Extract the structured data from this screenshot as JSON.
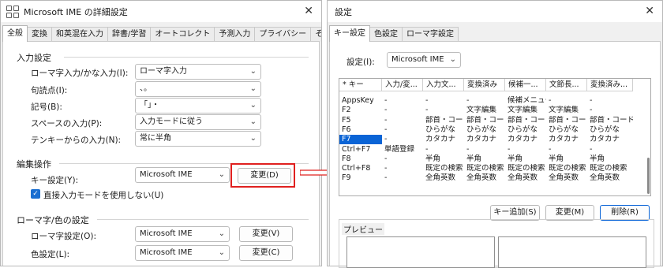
{
  "left_window": {
    "title": "Microsoft IME の詳細設定",
    "tabs": [
      "全般",
      "変換",
      "和英混在入力",
      "辞書/学習",
      "オートコレクト",
      "予測入力",
      "プライバシー",
      "その他"
    ],
    "input_section": {
      "title": "入力設定",
      "rows": [
        {
          "label": "ローマ字入力/かな入力(I):",
          "value": "ローマ字入力"
        },
        {
          "label": "句読点(I):",
          "value": "、。"
        },
        {
          "label": "記号(B):",
          "value": "「」・"
        },
        {
          "label": "スペースの入力(P):",
          "value": "入力モードに従う"
        },
        {
          "label": "テンキーからの入力(N):",
          "value": "常に半角"
        }
      ]
    },
    "edit_section": {
      "title": "編集操作",
      "key_label": "キー設定(Y):",
      "key_value": "Microsoft IME",
      "change_button": "変更(D)",
      "checkbox_label": "直接入力モードを使用しない(U)"
    },
    "romaji_section": {
      "title": "ローマ字/色の設定",
      "romaji_label": "ローマ字設定(O):",
      "romaji_value": "Microsoft IME",
      "romaji_button": "変更(V)",
      "color_label": "色設定(L):",
      "color_value": "Microsoft IME",
      "color_button": "変更(C)"
    }
  },
  "right_window": {
    "title": "設定",
    "tabs": [
      "キー設定",
      "色設定",
      "ローマ字設定"
    ],
    "setting_label": "設定(I):",
    "setting_value": "Microsoft IME",
    "grid": {
      "columns": [
        "* キー",
        "入力/変...",
        "入力文...",
        "変換済み",
        "候補一...",
        "文節長...",
        "変換済み..."
      ],
      "rows": [
        [
          "AppsKey",
          "-",
          "-",
          "-",
          "候補メニュー",
          "-",
          "-"
        ],
        [
          "F2",
          "-",
          "-",
          "文字編集",
          "文字編集",
          "文字編集",
          "-"
        ],
        [
          "F5",
          "-",
          "部首・コード変",
          "部首・コード変",
          "部首・コード変",
          "部首・コード変",
          "部首・コード変"
        ],
        [
          "F6",
          "-",
          "ひらがな",
          "ひらがな",
          "ひらがな",
          "ひらがな",
          "ひらがな"
        ],
        [
          "F7",
          "-",
          "カタカナ",
          "カタカナ",
          "カタカナ",
          "カタカナ",
          "カタカナ"
        ],
        [
          "Ctrl+F7",
          "単語登録",
          "-",
          "-",
          "-",
          "-",
          "-"
        ],
        [
          "F8",
          "-",
          "半角",
          "半角",
          "半角",
          "半角",
          "半角"
        ],
        [
          "Ctrl+F8",
          "-",
          "既定の検索",
          "既定の検索",
          "既定の検索",
          "既定の検索",
          "既定の検索"
        ],
        [
          "F9",
          "-",
          "全角英数",
          "全角英数",
          "全角英数",
          "全角英数",
          "全角英数"
        ]
      ],
      "selected_row_key": "F7"
    },
    "buttons": {
      "add": "キー追加(S)",
      "change": "変更(M)",
      "delete": "削除(R)"
    },
    "preview_title": "プレビュー"
  },
  "colors": {
    "highlight": "#e0201f",
    "accent": "#0a64d6"
  }
}
